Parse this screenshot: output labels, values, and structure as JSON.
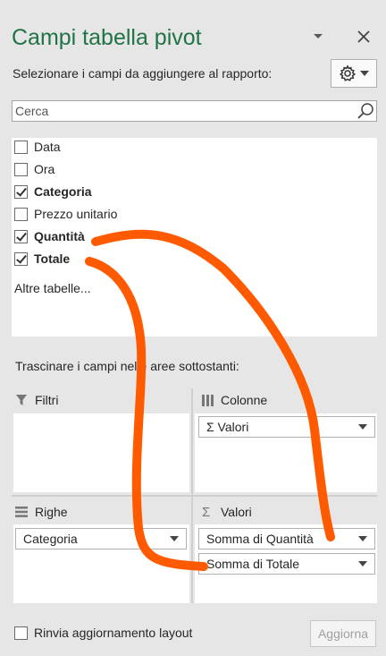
{
  "header": {
    "title": "Campi tabella pivot",
    "instructions": "Selezionare i campi da aggiungere al rapporto:"
  },
  "search": {
    "placeholder": "Cerca"
  },
  "fields": [
    {
      "label": "Data",
      "checked": false
    },
    {
      "label": "Ora",
      "checked": false
    },
    {
      "label": "Categoria",
      "checked": true
    },
    {
      "label": "Prezzo unitario",
      "checked": false
    },
    {
      "label": "Quantità",
      "checked": true
    },
    {
      "label": "Totale",
      "checked": true
    }
  ],
  "more_tables": "Altre tabelle...",
  "drag_hint": "Trascinare i campi nelle aree sottostanti:",
  "areas": {
    "filters": {
      "title": "Filtri"
    },
    "columns": {
      "title": "Colonne",
      "items": [
        "Σ Valori"
      ]
    },
    "rows": {
      "title": "Righe",
      "items": [
        "Categoria"
      ]
    },
    "values": {
      "title": "Valori",
      "items": [
        "Somma di Quantità",
        "Somma di Totale"
      ]
    }
  },
  "footer": {
    "defer_label": "Rinvia aggiornamento layout",
    "update_label": "Aggiorna"
  },
  "colors": {
    "title_green": "#217346",
    "annotation_orange": "#ff5a00"
  }
}
